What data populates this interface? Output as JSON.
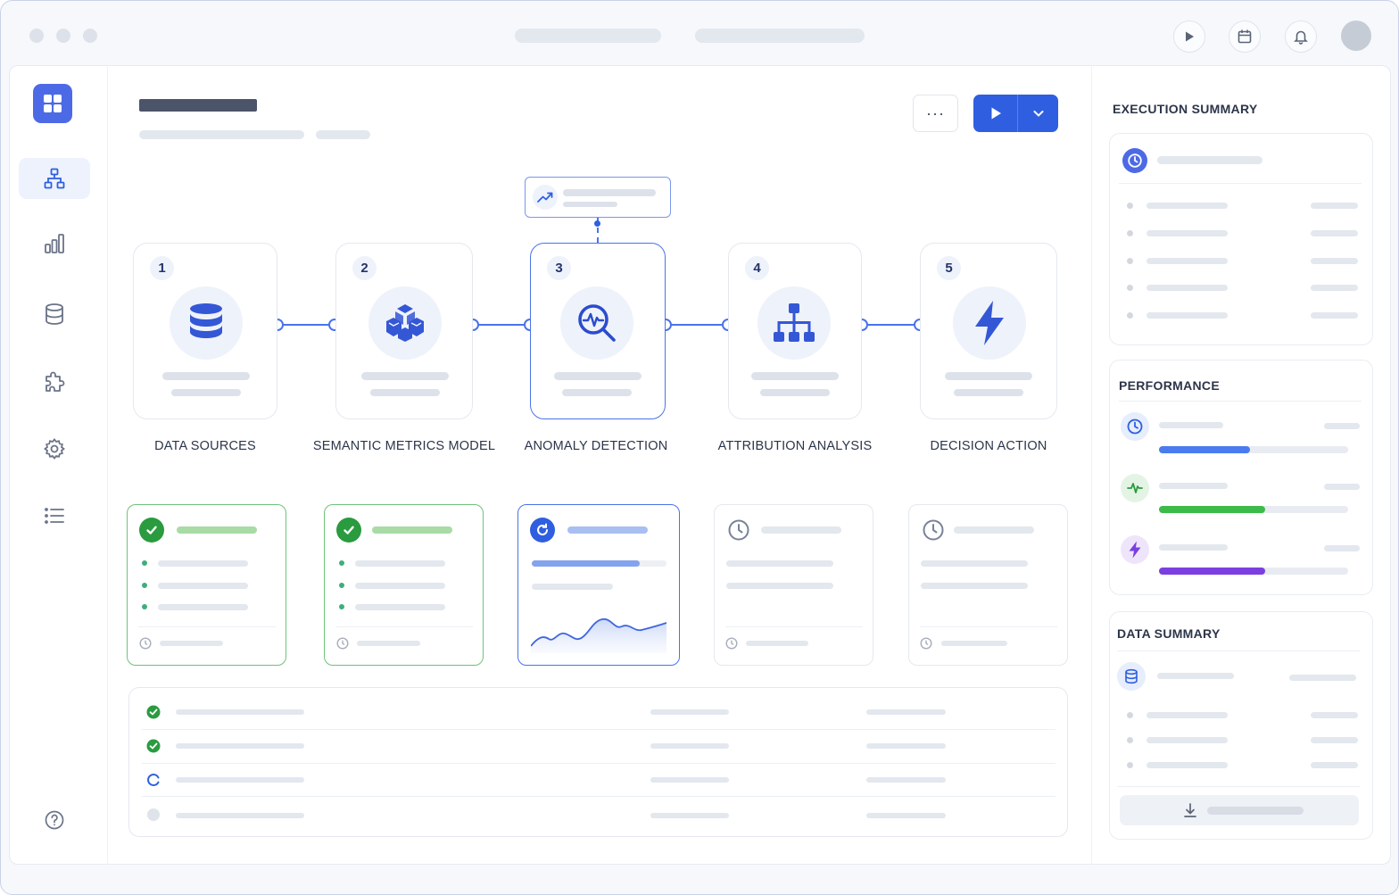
{
  "titlebar": {
    "icons": [
      "play-icon",
      "calendar-icon",
      "bell-icon"
    ]
  },
  "sidebar": {
    "items": [
      {
        "icon": "hierarchy-icon",
        "active": true
      },
      {
        "icon": "bar-chart-icon",
        "active": false
      },
      {
        "icon": "database-icon",
        "active": false
      },
      {
        "icon": "puzzle-icon",
        "active": false
      },
      {
        "icon": "gear-icon",
        "active": false
      },
      {
        "icon": "list-icon",
        "active": false
      }
    ],
    "help_icon": "help-icon"
  },
  "toolbar": {
    "more_label": "···",
    "run_icon": "play-icon",
    "run_menu_icon": "chevron-down-icon"
  },
  "pipeline": {
    "steps": [
      {
        "number": "1",
        "label": "DATA SOURCES",
        "icon": "database-icon"
      },
      {
        "number": "2",
        "label": "SEMANTIC METRICS MODEL",
        "icon": "cube-icon"
      },
      {
        "number": "3",
        "label": "ANOMALY DETECTION",
        "icon": "magnifier-pulse-icon",
        "active": true
      },
      {
        "number": "4",
        "label": "ATTRIBUTION ANALYSIS",
        "icon": "tree-icon"
      },
      {
        "number": "5",
        "label": "DECISION ACTION",
        "icon": "lightning-icon"
      }
    ],
    "callout_icon": "trend-up-icon"
  },
  "status_cards": [
    {
      "state": "completed",
      "icon": "check-circle-icon"
    },
    {
      "state": "completed",
      "icon": "check-circle-icon"
    },
    {
      "state": "running",
      "icon": "refresh-icon",
      "progress": 0.8
    },
    {
      "state": "pending",
      "icon": "clock-icon"
    },
    {
      "state": "pending",
      "icon": "clock-icon"
    }
  ],
  "run_log": {
    "rows": [
      {
        "state": "completed",
        "icon": "check-circle-icon"
      },
      {
        "state": "completed",
        "icon": "check-circle-icon"
      },
      {
        "state": "running",
        "icon": "spinner-icon"
      },
      {
        "state": "pending",
        "icon": "pending-dot-icon"
      }
    ]
  },
  "right_panel": {
    "execution_summary": {
      "title": "EXECUTION SUMMARY",
      "icon": "clock-icon"
    },
    "performance": {
      "title": "PERFORMANCE",
      "metrics": [
        {
          "icon": "clock-icon",
          "value": 0.48,
          "color": "#4a7cf0"
        },
        {
          "icon": "pulse-icon",
          "value": 0.56,
          "color": "#3dbb4a"
        },
        {
          "icon": "lightning-icon",
          "value": 0.56,
          "color": "#7b3fe0"
        }
      ]
    },
    "data_summary": {
      "title": "DATA SUMMARY",
      "icon": "database-icon",
      "download_icon": "download-icon"
    }
  },
  "colors": {
    "accent": "#2f5fe0",
    "success": "#2a9b3f",
    "running": "#2f5fe0",
    "pending": "#8a93a4"
  }
}
